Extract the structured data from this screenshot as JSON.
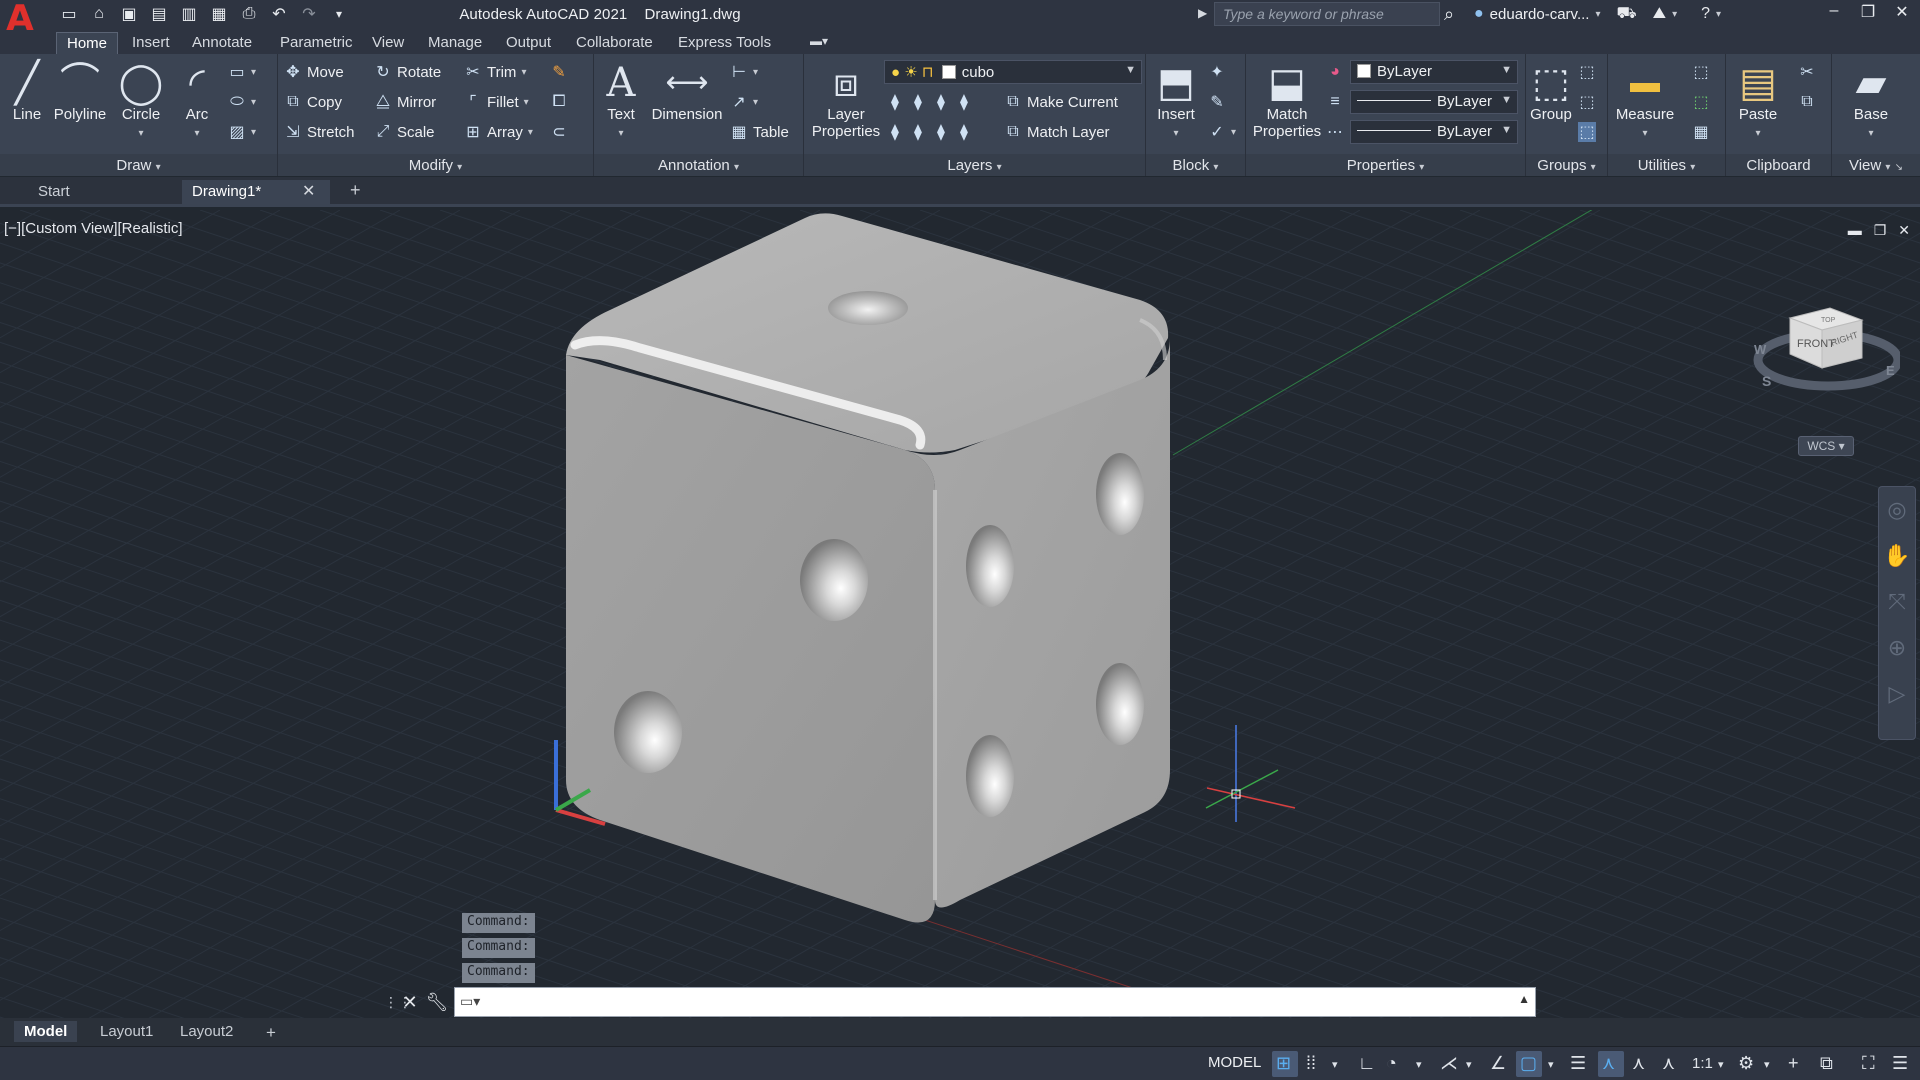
{
  "app": {
    "title": "Autodesk AutoCAD 2021",
    "document": "Drawing1.dwg",
    "search_placeholder": "Type a keyword or phrase",
    "user": "eduardo-carv..."
  },
  "ribbon_tabs": [
    "Home",
    "Insert",
    "Annotate",
    "Parametric",
    "View",
    "Manage",
    "Output",
    "Collaborate",
    "Express Tools"
  ],
  "panels": {
    "draw": {
      "title": "Draw",
      "line": "Line",
      "polyline": "Polyline",
      "circle": "Circle",
      "arc": "Arc"
    },
    "modify": {
      "title": "Modify",
      "move": "Move",
      "rotate": "Rotate",
      "trim": "Trim",
      "copy": "Copy",
      "mirror": "Mirror",
      "fillet": "Fillet",
      "stretch": "Stretch",
      "scale": "Scale",
      "array": "Array"
    },
    "annotation": {
      "title": "Annotation",
      "text": "Text",
      "dimension": "Dimension",
      "table": "Table"
    },
    "layers": {
      "title": "Layers",
      "layer_properties_1": "Layer",
      "layer_properties_2": "Properties",
      "current_layer": "cubo",
      "make_current": "Make Current",
      "match_layer": "Match Layer"
    },
    "block": {
      "title": "Block",
      "insert": "Insert"
    },
    "properties": {
      "title": "Properties",
      "match_1": "Match",
      "match_2": "Properties",
      "color": "ByLayer",
      "linetype": "ByLayer",
      "lineweight": "ByLayer"
    },
    "groups": {
      "title": "Groups",
      "group": "Group"
    },
    "utilities": {
      "title": "Utilities",
      "measure": "Measure"
    },
    "clipboard": {
      "title": "Clipboard",
      "paste": "Paste"
    },
    "view": {
      "title": "View",
      "base": "Base"
    }
  },
  "file_tabs": {
    "start": "Start",
    "drawing": "Drawing1*"
  },
  "viewport": {
    "label": "[−][Custom View][Realistic]",
    "viewcube": {
      "front": "FRONT",
      "right": "RIGHT",
      "top": "TOP",
      "south": "S",
      "west": "W",
      "east": "E"
    },
    "wcs": "WCS"
  },
  "command": {
    "history": [
      "Command:",
      "Command:",
      "Command:"
    ],
    "input_value": ""
  },
  "layout_tabs": [
    "Model",
    "Layout1",
    "Layout2"
  ],
  "status": {
    "model": "MODEL",
    "scale": "1:1"
  },
  "colors": {
    "background": "#222830",
    "ribbon": "#3b4453",
    "accent": "#5aaef0",
    "logo": "#e0302c"
  }
}
